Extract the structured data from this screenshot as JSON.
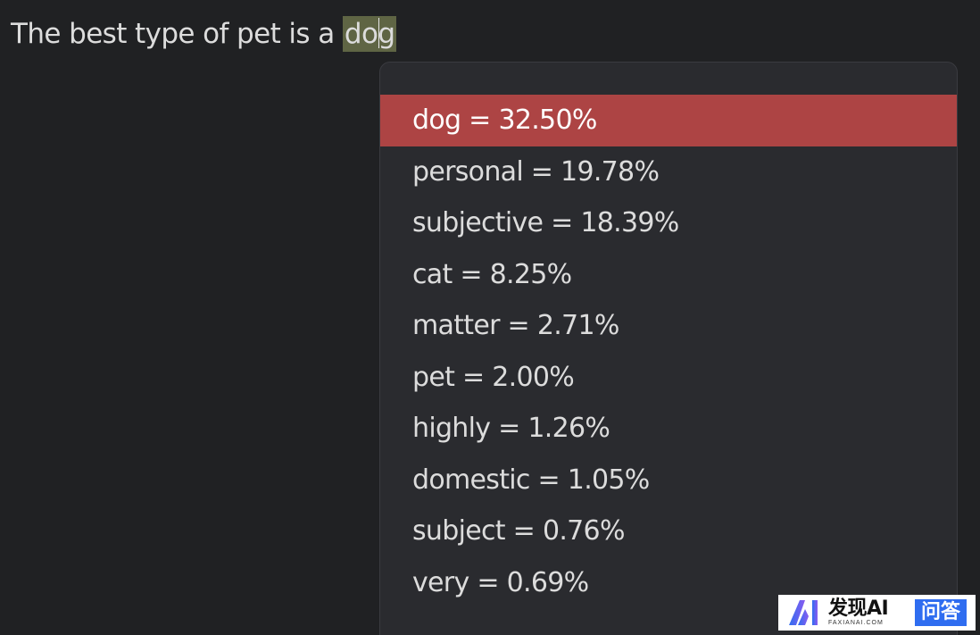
{
  "prompt": {
    "text": "The best type of pet is a",
    "completion_before_caret": "do",
    "completion_after_caret": "g"
  },
  "completions": {
    "selected_index": 0,
    "items": [
      {
        "label": "dog = 32.50%"
      },
      {
        "label": "personal = 19.78%"
      },
      {
        "label": "subjective = 18.39%"
      },
      {
        "label": "cat = 8.25%"
      },
      {
        "label": "matter = 2.71%"
      },
      {
        "label": "pet = 2.00%"
      },
      {
        "label": "highly = 1.26%"
      },
      {
        "label": "domestic = 1.05%"
      },
      {
        "label": "subject = 0.76%"
      },
      {
        "label": "very = 0.69%"
      }
    ]
  },
  "watermark": {
    "title": "发现AI",
    "subtitle": "FAXIANAI.COM",
    "badge": "问答"
  },
  "colors": {
    "background": "#202123",
    "popup_background": "#2a2b2f",
    "selected_row": "#ad4444",
    "completion_highlight": "#5f6544",
    "text": "#dcdcdc"
  }
}
